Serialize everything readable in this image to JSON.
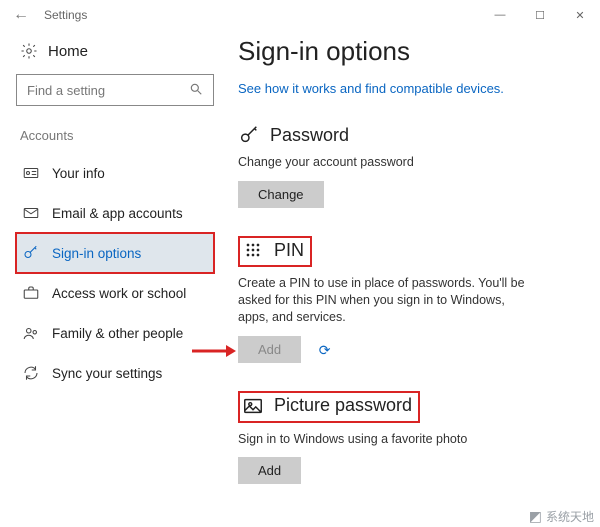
{
  "window": {
    "title": "Settings",
    "controls": {
      "min": "—",
      "max": "☐",
      "close": "✕"
    }
  },
  "sidebar": {
    "home_label": "Home",
    "search_placeholder": "Find a setting",
    "section_label": "Accounts",
    "items": [
      {
        "label": "Your info"
      },
      {
        "label": "Email & app accounts"
      },
      {
        "label": "Sign-in options"
      },
      {
        "label": "Access work or school"
      },
      {
        "label": "Family & other people"
      },
      {
        "label": "Sync your settings"
      }
    ]
  },
  "page": {
    "title": "Sign-in options",
    "link": "See how it works and find compatible devices."
  },
  "sections": {
    "password": {
      "heading": "Password",
      "desc": "Change your account password",
      "button": "Change"
    },
    "pin": {
      "heading": "PIN",
      "desc": "Create a PIN to use in place of passwords. You'll be asked for this PIN when you sign in to Windows, apps, and services.",
      "button": "Add"
    },
    "picture": {
      "heading": "Picture password",
      "desc": "Sign in to Windows using a favorite photo",
      "button": "Add"
    }
  },
  "watermark": {
    "text": "系统天地"
  }
}
